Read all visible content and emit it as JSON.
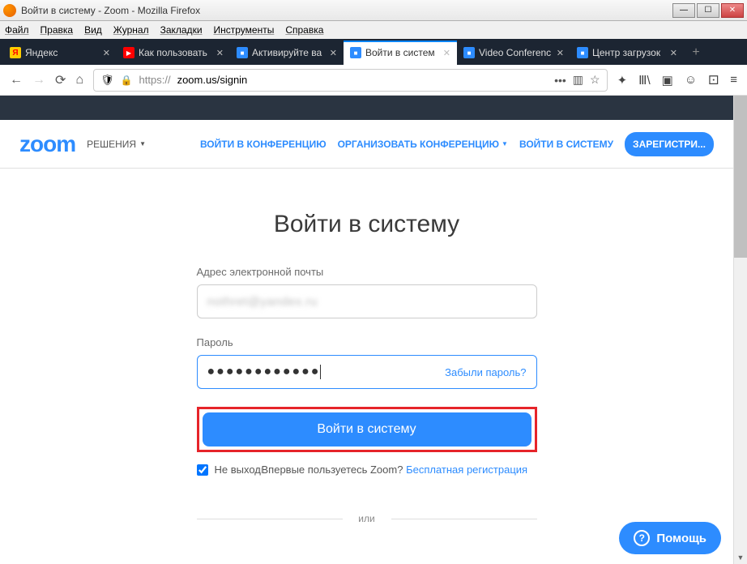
{
  "window": {
    "title": "Войти в систему - Zoom - Mozilla Firefox"
  },
  "menu": {
    "file": "Файл",
    "edit": "Правка",
    "view": "Вид",
    "history": "Журнал",
    "bookmarks": "Закладки",
    "tools": "Инструменты",
    "help": "Справка"
  },
  "tabs": [
    {
      "label": "Яндекс"
    },
    {
      "label": "Как пользовать"
    },
    {
      "label": "Активируйте ва"
    },
    {
      "label": "Войти в систем"
    },
    {
      "label": "Video Conferenc"
    },
    {
      "label": "Центр загрузок"
    }
  ],
  "urlbar": {
    "prefix": "https://",
    "url": "zoom.us/signin",
    "dots": "•••"
  },
  "zoom_nav": {
    "logo": "zoom",
    "solutions": "РЕШЕНИЯ",
    "join": "ВОЙТИ В КОНФЕРЕНЦИЮ",
    "host": "ОРГАНИЗОВАТЬ КОНФЕРЕНЦИЮ",
    "signin": "ВОЙТИ В СИСТЕМУ",
    "signup": "ЗАРЕГИСТРИ..."
  },
  "form": {
    "heading": "Войти в систему",
    "email_label": "Адрес электронной почты",
    "email_value": "nothret@yandex.ru",
    "password_label": "Пароль",
    "password_mask": "●●●●●●●●●●●●",
    "forgot": "Забыли пароль?",
    "submit": "Войти в систему",
    "stay_label": "Не выходить из системы",
    "new_user_prompt": "Впервые пользуетесь Zoom?",
    "register_link": "Бесплатная регистрация",
    "or": "или"
  },
  "help": {
    "label": "Помощь"
  }
}
